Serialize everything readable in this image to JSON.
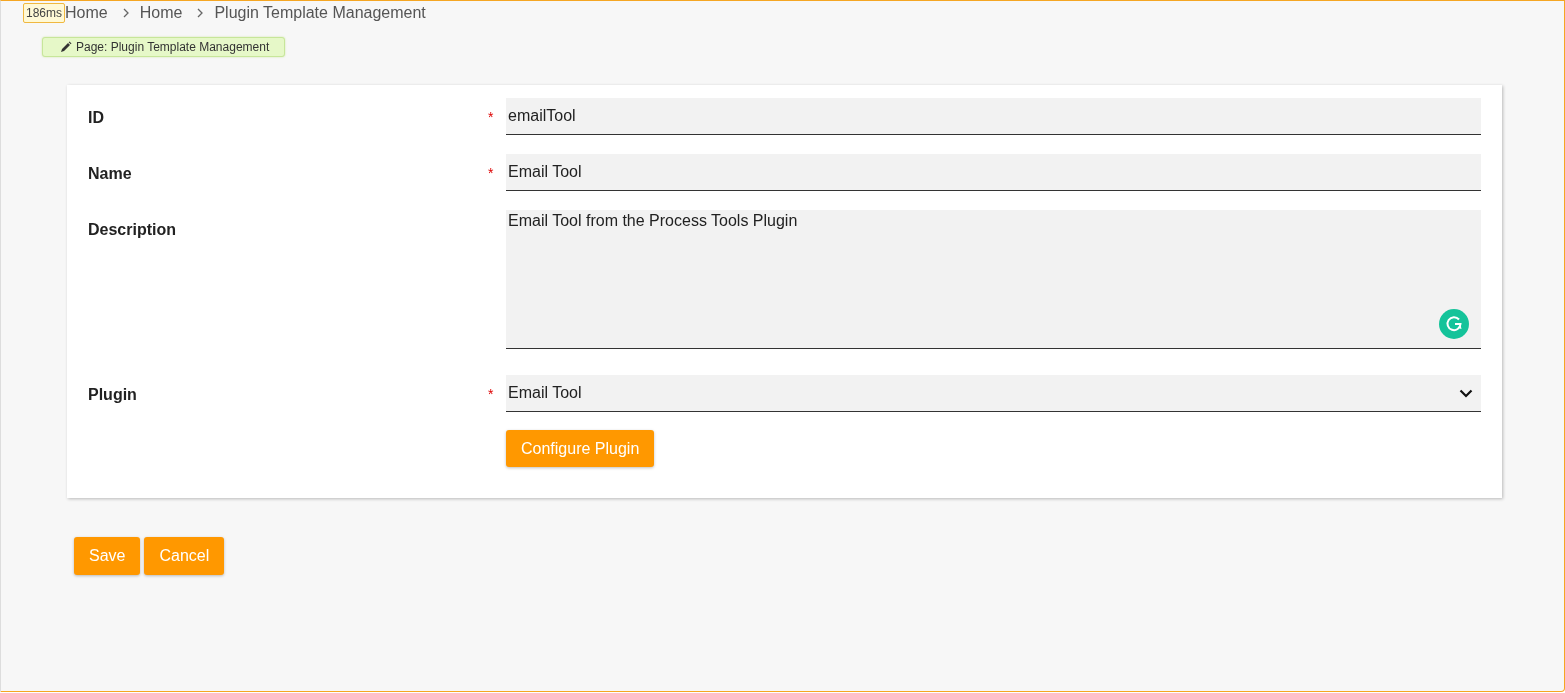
{
  "timer": "186ms",
  "breadcrumb": [
    "Home",
    "Home",
    "Plugin Template Management"
  ],
  "page_tag": "Page: Plugin Template Management",
  "form": {
    "fields": [
      {
        "kind": "text",
        "label": "ID",
        "required": true,
        "value": "emailTool"
      },
      {
        "kind": "text",
        "label": "Name",
        "required": true,
        "value": "Email Tool"
      },
      {
        "kind": "textarea",
        "label": "Description",
        "required": false,
        "value": "Email Tool from the Process Tools Plugin"
      },
      {
        "kind": "select",
        "label": "Plugin",
        "required": true,
        "value": "Email Tool"
      }
    ],
    "required_mark": "*",
    "configure_button": "Configure Plugin"
  },
  "buttons": [
    "Save",
    "Cancel"
  ]
}
